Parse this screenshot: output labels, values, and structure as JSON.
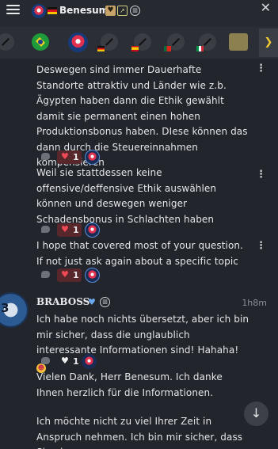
{
  "header": {
    "title": "Benesum",
    "close_symbol": "✕",
    "icons": [
      "menu-icon",
      "user-avatar",
      "germany-flag-icon",
      "heart-badge-icon",
      "chart-badge-icon",
      "bank-badge-icon",
      "close-icon"
    ]
  },
  "strip": {
    "items": [
      "compass-avatar",
      "brazil-avatar",
      "benesum-avatar",
      "compass-de-avatar",
      "compass-es-avatar",
      "compass-pt-avatar",
      "compass-it-avatar",
      "compass-bank-avatar",
      "gold-avatar"
    ],
    "more_arrow": "❯"
  },
  "messages": [
    {
      "text": "Deswegen sind immer Dauerhafte Standorte attraktiv und Länder wie z.b. Ägypten haben dann die Ethik gewählt damit sie permanent einen hohen Produktionsbonus haben. DIese können das dann durch die Steuereinnahmen kompensieren",
      "hearts": "1"
    },
    {
      "text": "Weil sie stattdessen keine offensive/deffensive Ethik auswählen können und deswegen weniger Schadensbonus in Schlachten haben",
      "hearts": "1"
    },
    {
      "text": "I hope that covered most of your question. If not just ask again about a specific topic",
      "hearts": "1"
    }
  ],
  "author": {
    "name": "BRABOSS",
    "timestamp": "1h8m",
    "avatar_number": "3",
    "icons": [
      "heart-badge-icon",
      "bank-badge-icon"
    ]
  },
  "reply_messages": [
    {
      "text": "Ich habe noch nichts übersetzt, aber ich bin mir sicher, dass die unglaublich interessante Informationen sind! Hahaha!",
      "hearts": "1"
    },
    {
      "text": "Vielen Dank, Herr Benesum. Ich danke Ihnen herzlich für die Informationen."
    },
    {
      "text": "Ich möchte nicht zu viel Ihrer Zeit in Anspruch nehmen. Ich bin mir sicher, dass Sie ein"
    }
  ],
  "colors": {
    "background": "#22252b",
    "heart": "#ef4a56",
    "reaction_pill": "#57272b",
    "accent_blue": "#6da8ee"
  }
}
